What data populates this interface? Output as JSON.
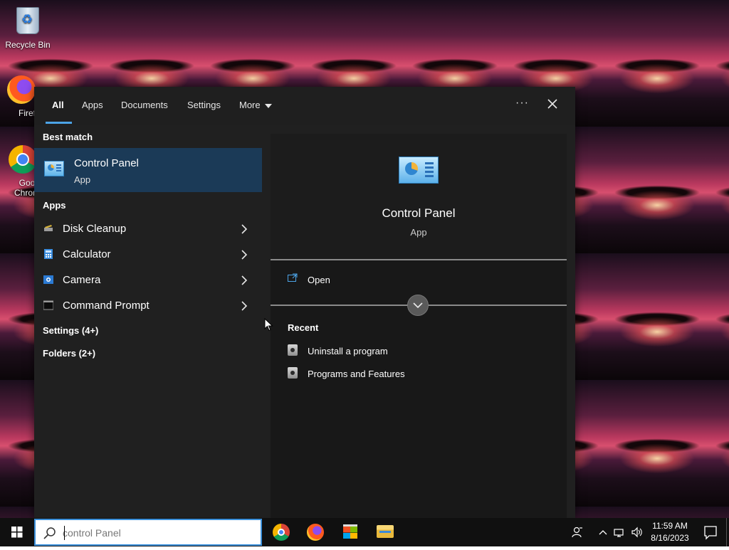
{
  "desktop": {
    "icons": [
      {
        "label": "Recycle Bin",
        "icon": "recycle-bin-icon"
      },
      {
        "label": "Firefc",
        "icon": "firefox-icon"
      },
      {
        "label": "Goog\nChrom",
        "icon": "chrome-icon"
      }
    ]
  },
  "search_panel": {
    "tabs": [
      {
        "label": "All",
        "active": true
      },
      {
        "label": "Apps"
      },
      {
        "label": "Documents"
      },
      {
        "label": "Settings"
      },
      {
        "label": "More"
      }
    ],
    "options_label": "···",
    "best_match": {
      "header": "Best match",
      "title": "Control Panel",
      "subtitle": "App",
      "icon": "control-panel-icon"
    },
    "apps": {
      "header": "Apps",
      "items": [
        {
          "label": "Disk Cleanup",
          "icon": "disk-cleanup-icon"
        },
        {
          "label": "Calculator",
          "icon": "calculator-icon"
        },
        {
          "label": "Camera",
          "icon": "camera-icon"
        },
        {
          "label": "Command Prompt",
          "icon": "command-prompt-icon"
        }
      ]
    },
    "settings_link": "Settings (4+)",
    "folders_link": "Folders (2+)",
    "preview": {
      "title": "Control Panel",
      "subtitle": "App",
      "open_label": "Open",
      "recent_header": "Recent",
      "recent_items": [
        {
          "label": "Uninstall a program"
        },
        {
          "label": "Programs and Features"
        }
      ]
    }
  },
  "taskbar": {
    "search_text": "control Panel",
    "pinned": [
      {
        "name": "chrome-icon"
      },
      {
        "name": "firefox-icon"
      },
      {
        "name": "microsoft-store-icon"
      },
      {
        "name": "file-explorer-icon"
      }
    ],
    "clock_time": "11:59 AM",
    "clock_date": "8/16/2023"
  },
  "colors": {
    "accent": "#4ca3e6",
    "selection": "#1b3a57",
    "panel": "#202020",
    "taskbar": "#101010"
  }
}
